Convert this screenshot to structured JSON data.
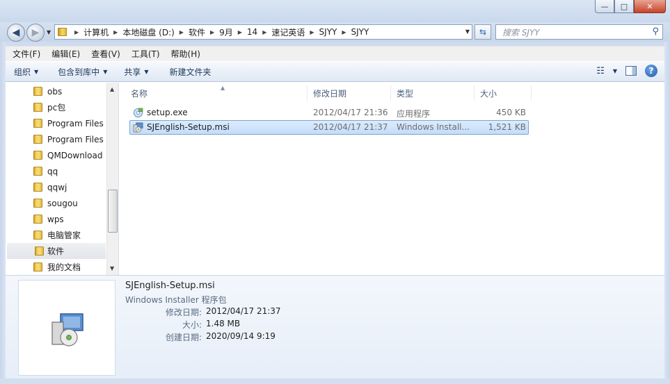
{
  "titlebar": {
    "minimize": "—",
    "maximize": "□",
    "close": "✕"
  },
  "nav": {
    "back_icon": "back-arrow-icon",
    "forward_icon": "forward-arrow-icon",
    "breadcrumbs": [
      "计算机",
      "本地磁盘 (D:)",
      "软件",
      "9月",
      "14",
      "速记英语",
      "SJYY",
      "SJYY"
    ],
    "search_placeholder": "搜索 SJYY"
  },
  "menubar": {
    "items": [
      "文件(F)",
      "编辑(E)",
      "查看(V)",
      "工具(T)",
      "帮助(H)"
    ]
  },
  "commandbar": {
    "organize": "组织",
    "include_in_library": "包含到库中",
    "share": "共享",
    "new_folder": "新建文件夹"
  },
  "navpane": {
    "items": [
      {
        "label": "obs"
      },
      {
        "label": "pc包"
      },
      {
        "label": "Program Files"
      },
      {
        "label": "Program Files"
      },
      {
        "label": "QMDownload"
      },
      {
        "label": "qq"
      },
      {
        "label": "qqwj"
      },
      {
        "label": "sougou"
      },
      {
        "label": "wps"
      },
      {
        "label": "电脑管家"
      },
      {
        "label": "软件",
        "selected": true
      },
      {
        "label": "我的文档"
      }
    ]
  },
  "filelist": {
    "columns": {
      "name": "名称",
      "date": "修改日期",
      "type": "类型",
      "size": "大小"
    },
    "rows": [
      {
        "name": "setup.exe",
        "date": "2012/04/17 21:36",
        "type": "应用程序",
        "size": "450 KB",
        "icon": "exe-setup-icon",
        "selected": false
      },
      {
        "name": "SJEnglish-Setup.msi",
        "date": "2012/04/17 21:37",
        "type": "Windows Install...",
        "size": "1,521 KB",
        "icon": "msi-installer-icon",
        "selected": true
      }
    ]
  },
  "details": {
    "name": "SJEnglish-Setup.msi",
    "type": "Windows Installer 程序包",
    "modified_label": "修改日期:",
    "modified_value": "2012/04/17 21:37",
    "size_label": "大小:",
    "size_value": "1.48 MB",
    "created_label": "创建日期:",
    "created_value": "2020/09/14 9:19"
  }
}
